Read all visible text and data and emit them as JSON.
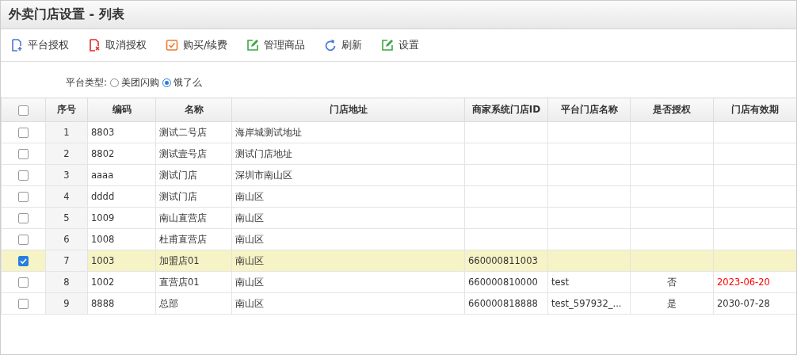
{
  "window": {
    "title": "外卖门店设置 - 列表"
  },
  "toolbar": [
    {
      "label": "平台授权",
      "kind": "doc-plus"
    },
    {
      "label": "取消授权",
      "kind": "doc-x"
    },
    {
      "label": "购买/续费",
      "kind": "check"
    },
    {
      "label": "管理商品",
      "kind": "edit"
    },
    {
      "label": "刷新",
      "kind": "refresh"
    },
    {
      "label": "设置",
      "kind": "edit"
    }
  ],
  "filter": {
    "label": "平台类型:",
    "options": [
      {
        "label": "美团闪购",
        "selected": false
      },
      {
        "label": "饿了么",
        "selected": true
      }
    ]
  },
  "table": {
    "all_checked": false,
    "columns": [
      "序号",
      "编码",
      "名称",
      "门店地址",
      "商家系统门店ID",
      "平台门店名称",
      "是否授权",
      "门店有效期"
    ],
    "rows": [
      {
        "checked": false,
        "cells": [
          "1",
          "8803",
          "测试二号店",
          "海岸城测试地址",
          "",
          "",
          "",
          ""
        ],
        "expired": false
      },
      {
        "checked": false,
        "cells": [
          "2",
          "8802",
          "测试壹号店",
          "测试门店地址",
          "",
          "",
          "",
          ""
        ],
        "expired": false
      },
      {
        "checked": false,
        "cells": [
          "3",
          "aaaa",
          "测试门店",
          "深圳市南山区",
          "",
          "",
          "",
          ""
        ],
        "expired": false
      },
      {
        "checked": false,
        "cells": [
          "4",
          "dddd",
          "测试门店",
          "南山区",
          "",
          "",
          "",
          ""
        ],
        "expired": false
      },
      {
        "checked": false,
        "cells": [
          "5",
          "1009",
          "南山直营店",
          "南山区",
          "",
          "",
          "",
          ""
        ],
        "expired": false
      },
      {
        "checked": false,
        "cells": [
          "6",
          "1008",
          "杜甫直营店",
          "南山区",
          "",
          "",
          "",
          ""
        ],
        "expired": false
      },
      {
        "checked": true,
        "cells": [
          "7",
          "1003",
          "加盟店01",
          "南山区",
          "660000811003",
          "",
          "",
          ""
        ],
        "expired": false
      },
      {
        "checked": false,
        "cells": [
          "8",
          "1002",
          "直营店01",
          "南山区",
          "660000810000",
          "test",
          "否",
          "2023-06-20"
        ],
        "expired": true
      },
      {
        "checked": false,
        "cells": [
          "9",
          "8888",
          "总部",
          "南山区",
          "660000818888",
          "test_597932_...",
          "是",
          "2030-07-28"
        ],
        "expired": false
      }
    ]
  }
}
